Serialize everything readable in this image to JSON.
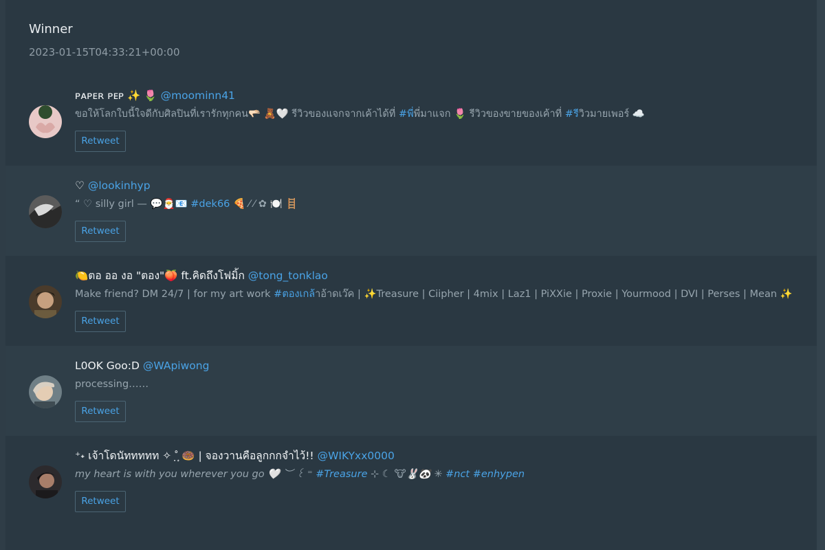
{
  "header": {
    "title": "Winner",
    "timestamp": "2023-01-15T04:33:21+00:00"
  },
  "retweet_label": "Retweet",
  "entries": [
    {
      "name": "ᴘᴀᴘᴇʀ ᴘᴇᴘ ✨ 🌷",
      "handle": "@moominn41",
      "bio": [
        {
          "text": "ขอให้โลกใบนี้ใจดีกับศิลปินที่เรารักทุกคน🫳🏻 🧸🤍 รีวิวของแจกจากเค้าได้ที่ ",
          "tag": false
        },
        {
          "text": "#พ",
          "tag": true
        },
        {
          "text": "ี่พี่มาแจก 🌷 รีวิวของขายของเค้าที่ ",
          "tag": false
        },
        {
          "text": "#ร",
          "tag": true
        },
        {
          "text": "ีวิวมายเพอร์ ☁️",
          "tag": false
        }
      ]
    },
    {
      "name": "♡",
      "handle": "@lookinhyp",
      "bio": [
        {
          "text": "“ ♡ silly girl — 💬🎅📧 ",
          "tag": false
        },
        {
          "text": "#dek66",
          "tag": true
        },
        {
          "text": " 🍕 ⁄ ⁄ ✿ 🍽️ 🪜",
          "tag": false
        }
      ]
    },
    {
      "name": "🍋ตอ ออ งอ \"ตอง\"🍑 ft.คิดถึงโฟมิ้ก",
      "handle": "@tong_tonklao",
      "bio": [
        {
          "text": "Make friend? DM 24/7 | for my art work ",
          "tag": false
        },
        {
          "text": "#ตองเกล",
          "tag": true
        },
        {
          "text": "้าอ้าดเว๊ค | ✨Treasure | Ciipher | 4mix | Laz1 | PiXXie | Proxie | Yourmood | DVI | Perses | Mean ✨",
          "tag": false
        }
      ]
    },
    {
      "name": "L0OK Goo:D",
      "handle": "@WApiwong",
      "bio": [
        {
          "text": "processing……",
          "tag": false
        }
      ]
    },
    {
      "name": "⁺˖ เจ้าโดนัททททท ✧ ˚̣̣̣͙ 🍩 | จองวานคือลูกกกจำไว้!!",
      "handle": "@WIKYxx0000",
      "italic": true,
      "bio": [
        {
          "text": "my heart is with you wherever you go 🤍 ︶ ꒰ ⁼ ",
          "tag": false
        },
        {
          "text": "#Treasure",
          "tag": true
        },
        {
          "text": " ⊹ ☾ 🐮🐰🐼 ✳ ",
          "tag": false
        },
        {
          "text": "#nct #enhypen",
          "tag": true
        }
      ]
    }
  ],
  "avatars": [
    {
      "icon": "avatar-heart-hands",
      "bg": "#e8c9c7",
      "fg": "#3e5a3a"
    },
    {
      "icon": "avatar-bw-photo",
      "bg": "#5b5b5b",
      "fg": "#d9d9d9"
    },
    {
      "icon": "avatar-person-photo",
      "bg": "#4a3b2b",
      "fg": "#c7a07f"
    },
    {
      "icon": "avatar-blonde-photo",
      "bg": "#d8cfc2",
      "fg": "#8a6f55"
    },
    {
      "icon": "avatar-dark-photo",
      "bg": "#2c2a2d",
      "fg": "#a87e6a"
    }
  ]
}
